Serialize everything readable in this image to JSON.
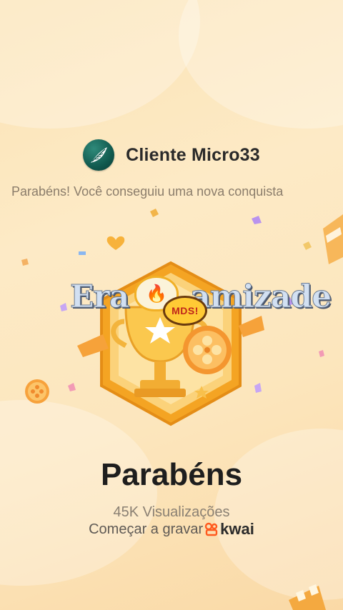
{
  "header": {
    "avatar_icon": "feather-icon",
    "user_name": "Cliente Micro33"
  },
  "subtitle": "Parabéns! Você conseguiu uma nova conquista",
  "badge": {
    "icon": "trophy-film-reel-badge-icon",
    "colors": {
      "hex_border": "#f4a423",
      "hex_fill": "#fbd27a"
    }
  },
  "overlay": {
    "caption": "Era da amizade",
    "fire_emoji": "🔥",
    "sticker_text": "MDS!"
  },
  "achievement": {
    "title": "Parabéns",
    "views": "45K Visualizações"
  },
  "cta": {
    "label": "Começar a gravar",
    "brand": "kwai",
    "brand_color": "#ff5a1f"
  }
}
